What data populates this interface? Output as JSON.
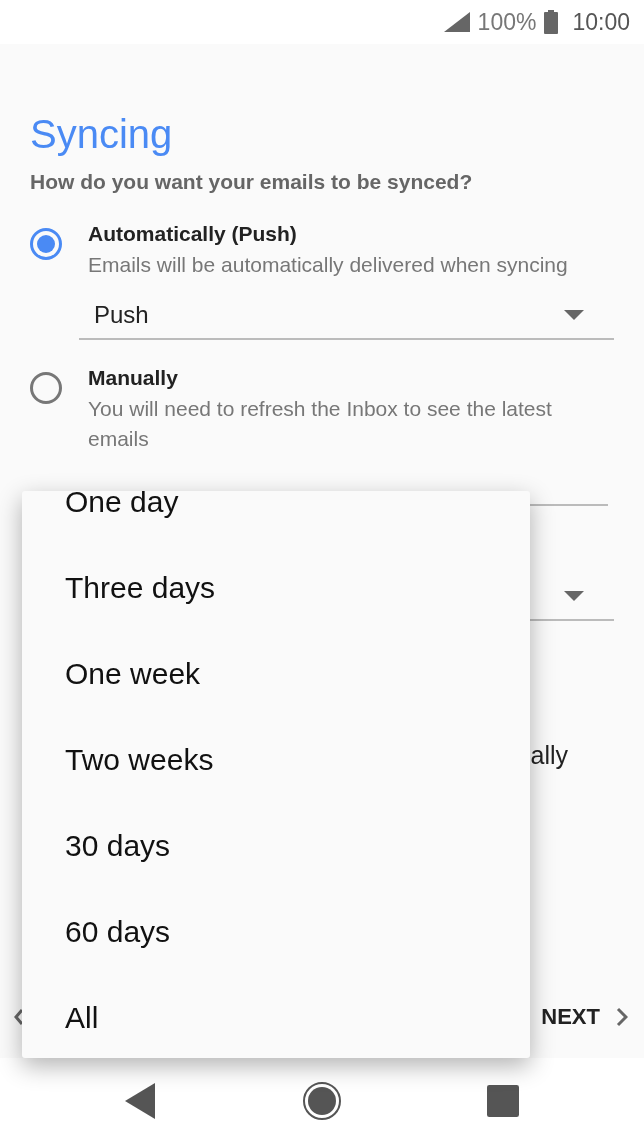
{
  "status_bar": {
    "battery": "100%",
    "time": "10:00"
  },
  "title": "Syncing",
  "question": "How do you want your emails to be synced?",
  "options": [
    {
      "label": "Automatically (Push)",
      "description": "Emails will be automatically delivered when syncing",
      "selected": true,
      "dropdown": {
        "value": "Push"
      }
    },
    {
      "label": "Manually",
      "description": "You will need to refresh the Inbox to see the latest emails",
      "selected": false
    }
  ],
  "partial_text": "ally",
  "footer": {
    "next": "NEXT"
  },
  "menu": {
    "items": [
      {
        "label": "One day"
      },
      {
        "label": "Three days"
      },
      {
        "label": "One week"
      },
      {
        "label": "Two weeks"
      },
      {
        "label": "30 days"
      },
      {
        "label": "60 days"
      },
      {
        "label": "All"
      }
    ]
  }
}
